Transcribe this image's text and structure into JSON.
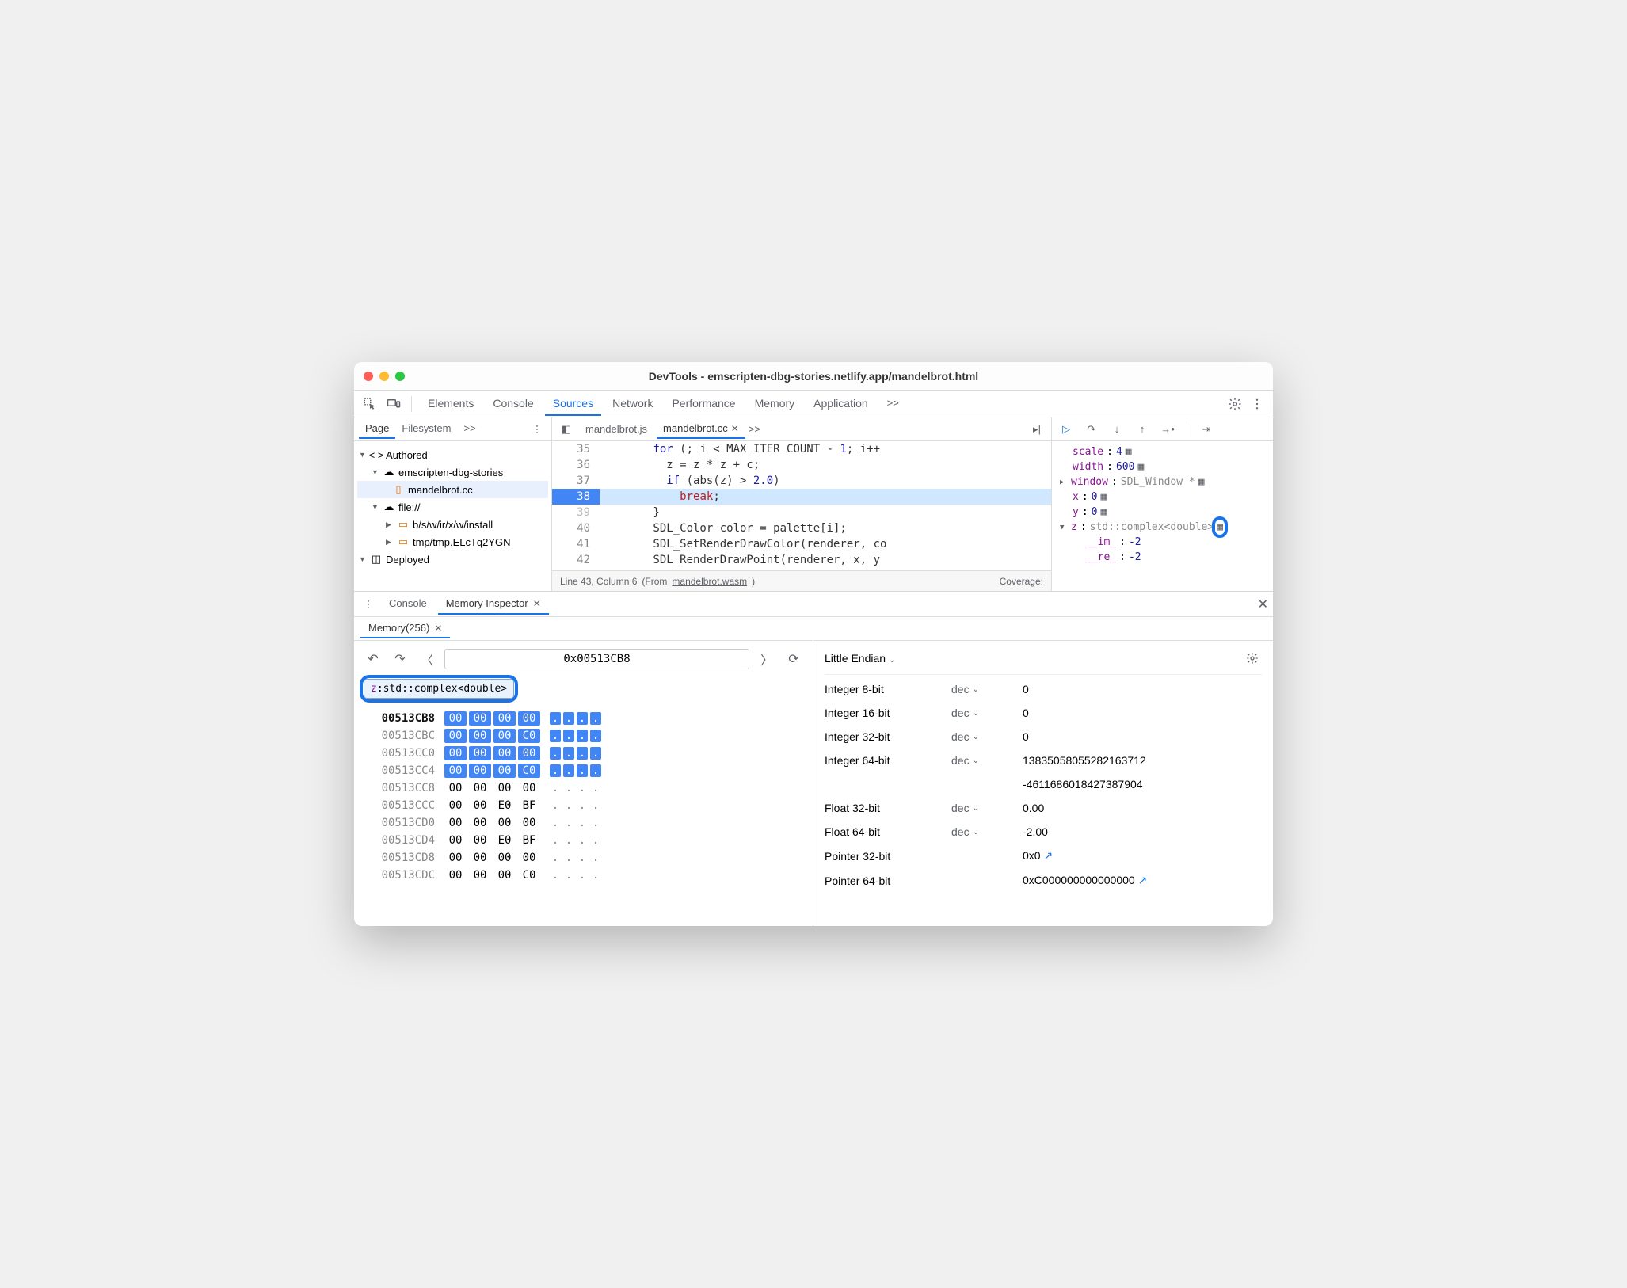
{
  "window": {
    "title": "DevTools - emscripten-dbg-stories.netlify.app/mandelbrot.html"
  },
  "toolbar": {
    "tabs": [
      "Elements",
      "Console",
      "Sources",
      "Network",
      "Performance",
      "Memory",
      "Application"
    ],
    "active": "Sources",
    "more": ">>"
  },
  "nav": {
    "tabs": [
      "Page",
      "Filesystem"
    ],
    "active": "Page",
    "more": ">>",
    "tree": {
      "authored": "Authored",
      "origin": "emscripten-dbg-stories",
      "file": "mandelbrot.cc",
      "fileorigin": "file://",
      "folder1": "b/s/w/ir/x/w/install",
      "folder2": "tmp/tmp.ELcTq2YGN",
      "deployed": "Deployed"
    }
  },
  "editor": {
    "tabs": [
      {
        "label": "mandelbrot.js",
        "active": false
      },
      {
        "label": "mandelbrot.cc",
        "active": true
      }
    ],
    "more": ">>",
    "lines": [
      {
        "n": 35,
        "txt": "        for (; i < MAX_ITER_COUNT - 1; i++"
      },
      {
        "n": 36,
        "txt": "          z = z * z + c;"
      },
      {
        "n": 37,
        "txt": "          if (abs(z) > 2.0)"
      },
      {
        "n": 38,
        "txt": "            break;",
        "hl": true,
        "break": "break"
      },
      {
        "n": 39,
        "txt": "        }"
      },
      {
        "n": 40,
        "txt": "        SDL_Color color = palette[i];"
      },
      {
        "n": 41,
        "txt": "        SDL_SetRenderDrawColor(renderer, co"
      },
      {
        "n": 42,
        "txt": "        SDL_RenderDrawPoint(renderer, x, y"
      }
    ],
    "status": {
      "pos": "Line 43, Column 6",
      "from": "(From ",
      "wasm": "mandelbrot.wasm",
      "close": ")",
      "cov": "Coverage:"
    }
  },
  "scope": {
    "vars": [
      {
        "name": "scale",
        "val": "4",
        "icon": true
      },
      {
        "name": "width",
        "val": "600",
        "icon": true
      },
      {
        "name": "window",
        "val": "SDL_Window *",
        "icon": true,
        "exp": "▶"
      },
      {
        "name": "x",
        "val": "0",
        "icon": true
      },
      {
        "name": "y",
        "val": "0",
        "icon": true
      },
      {
        "name": "z",
        "val": "std::complex<double>",
        "icon": true,
        "exp": "▼",
        "ring": true
      },
      {
        "name": "__im_",
        "val": "-2",
        "indent": true
      },
      {
        "name": "__re_",
        "val": "-2",
        "indent": true
      }
    ]
  },
  "drawer": {
    "tabs": [
      {
        "label": "Console",
        "active": false
      },
      {
        "label": "Memory Inspector",
        "active": true
      }
    ],
    "memtab": "Memory(256)"
  },
  "hex": {
    "address": "0x00513CB8",
    "chip": {
      "name": "z",
      "type": "std::complex<double>"
    },
    "rows": [
      {
        "addr": "00513CB8",
        "b": [
          "00",
          "00",
          "00",
          "00"
        ],
        "h": true,
        "bold": true
      },
      {
        "addr": "00513CBC",
        "b": [
          "00",
          "00",
          "00",
          "C0"
        ],
        "h": true
      },
      {
        "addr": "00513CC0",
        "b": [
          "00",
          "00",
          "00",
          "00"
        ],
        "h": true
      },
      {
        "addr": "00513CC4",
        "b": [
          "00",
          "00",
          "00",
          "C0"
        ],
        "h": true
      },
      {
        "addr": "00513CC8",
        "b": [
          "00",
          "00",
          "00",
          "00"
        ],
        "h": false
      },
      {
        "addr": "00513CCC",
        "b": [
          "00",
          "00",
          "E0",
          "BF"
        ],
        "h": false
      },
      {
        "addr": "00513CD0",
        "b": [
          "00",
          "00",
          "00",
          "00"
        ],
        "h": false
      },
      {
        "addr": "00513CD4",
        "b": [
          "00",
          "00",
          "E0",
          "BF"
        ],
        "h": false
      },
      {
        "addr": "00513CD8",
        "b": [
          "00",
          "00",
          "00",
          "00"
        ],
        "h": false
      },
      {
        "addr": "00513CDC",
        "b": [
          "00",
          "00",
          "00",
          "C0"
        ],
        "h": false
      }
    ]
  },
  "values": {
    "endian": "Little Endian",
    "fmt": "dec",
    "rows": [
      {
        "label": "Integer 8-bit",
        "fmt": "dec",
        "val": "0"
      },
      {
        "label": "Integer 16-bit",
        "fmt": "dec",
        "val": "0"
      },
      {
        "label": "Integer 32-bit",
        "fmt": "dec",
        "val": "0"
      },
      {
        "label": "Integer 64-bit",
        "fmt": "dec",
        "val": "13835058055282163712",
        "val2": "-4611686018427387904"
      },
      {
        "label": "Float 32-bit",
        "fmt": "dec",
        "val": "0.00"
      },
      {
        "label": "Float 64-bit",
        "fmt": "dec",
        "val": "-2.00"
      },
      {
        "label": "Pointer 32-bit",
        "fmt": "",
        "val": "0x0",
        "link": true
      },
      {
        "label": "Pointer 64-bit",
        "fmt": "",
        "val": "0xC000000000000000",
        "link": true
      }
    ]
  }
}
